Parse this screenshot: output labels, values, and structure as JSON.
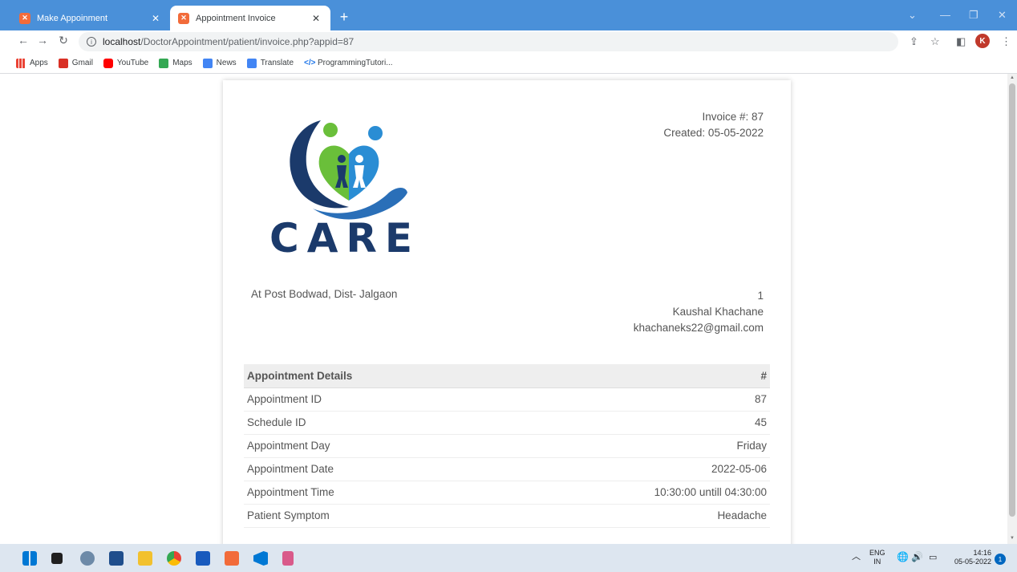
{
  "browser": {
    "tabs": [
      {
        "label": "Make Appoinment"
      },
      {
        "label": "Appointment Invoice"
      }
    ],
    "url": {
      "host": "localhost",
      "path": "/DoctorAppointment/patient/invoice.php?appid=87"
    },
    "profile_initial": "K",
    "bookmarks": [
      {
        "label": "Apps",
        "color": "#ea4335"
      },
      {
        "label": "Gmail",
        "color": "#d93025"
      },
      {
        "label": "YouTube",
        "color": "#ff0000"
      },
      {
        "label": "Maps",
        "color": "#34a853"
      },
      {
        "label": "News",
        "color": "#4285f4"
      },
      {
        "label": "Translate",
        "color": "#4285f4"
      },
      {
        "label": "ProgrammingTutori...",
        "color": "#1a73e8"
      }
    ]
  },
  "invoice": {
    "number": "Invoice #: 87",
    "created": "Created: 05-05-2022",
    "logo_text": "CARE",
    "address": "At Post Bodwad, Dist- Jalgaon",
    "patient": {
      "id": "1",
      "name": "Kaushal Khachane",
      "email": "khachaneks22@gmail.com"
    },
    "table": {
      "header": {
        "label": "Appointment Details",
        "value": "#"
      },
      "rows": [
        {
          "label": "Appointment ID",
          "value": "87"
        },
        {
          "label": "Schedule ID",
          "value": "45"
        },
        {
          "label": "Appointment Day",
          "value": "Friday"
        },
        {
          "label": "Appointment Date",
          "value": "2022-05-06"
        },
        {
          "label": "Appointment Time",
          "value": "10:30:00 untill 04:30:00"
        },
        {
          "label": "Patient Symptom",
          "value": "Headache"
        }
      ]
    }
  },
  "taskbar": {
    "lang": "ENG",
    "region": "IN",
    "time": "14:16",
    "date": "05-05-2022",
    "notifications": "1"
  },
  "colors": {
    "brand_navy": "#1b3a6b",
    "brand_green": "#6abf3a",
    "brand_blue": "#2a8dd4"
  }
}
